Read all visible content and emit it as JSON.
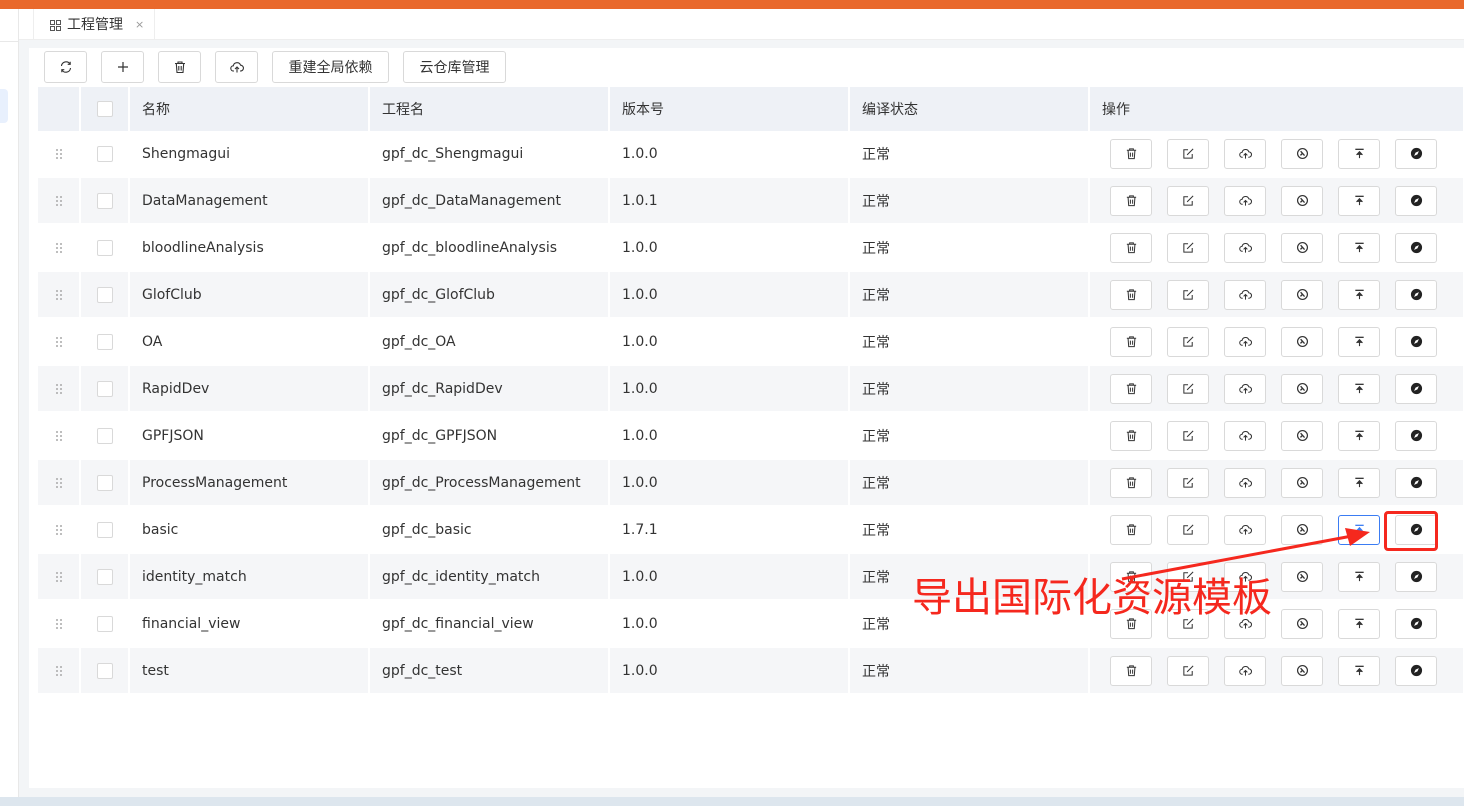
{
  "tabbar": {
    "tab_label": "工程管理",
    "tab_close": "×"
  },
  "toolbar": {
    "rebuild_label": "重建全局依赖",
    "cloud_label": "云仓库管理"
  },
  "table": {
    "headers": [
      "名称",
      "工程名",
      "版本号",
      "编译状态",
      "操作"
    ],
    "rows": [
      {
        "name": "Shengmagui",
        "project": "gpf_dc_Shengmagui",
        "version": "1.0.0",
        "status": "正常"
      },
      {
        "name": "DataManagement",
        "project": "gpf_dc_DataManagement",
        "version": "1.0.1",
        "status": "正常"
      },
      {
        "name": "bloodlineAnalysis",
        "project": "gpf_dc_bloodlineAnalysis",
        "version": "1.0.0",
        "status": "正常"
      },
      {
        "name": "GlofClub",
        "project": "gpf_dc_GlofClub",
        "version": "1.0.0",
        "status": "正常"
      },
      {
        "name": "OA",
        "project": "gpf_dc_OA",
        "version": "1.0.0",
        "status": "正常"
      },
      {
        "name": "RapidDev",
        "project": "gpf_dc_RapidDev",
        "version": "1.0.0",
        "status": "正常"
      },
      {
        "name": "GPFJSON",
        "project": "gpf_dc_GPFJSON",
        "version": "1.0.0",
        "status": "正常"
      },
      {
        "name": "ProcessManagement",
        "project": "gpf_dc_ProcessManagement",
        "version": "1.0.0",
        "status": "正常"
      },
      {
        "name": "basic",
        "project": "gpf_dc_basic",
        "version": "1.7.1",
        "status": "正常"
      },
      {
        "name": "identity_match",
        "project": "gpf_dc_identity_match",
        "version": "1.0.0",
        "status": "正常"
      },
      {
        "name": "financial_view",
        "project": "gpf_dc_financial_view",
        "version": "1.0.0",
        "status": "正常"
      },
      {
        "name": "test",
        "project": "gpf_dc_test",
        "version": "1.0.0",
        "status": "正常"
      }
    ]
  },
  "annotation": {
    "text": "导出国际化资源模板"
  },
  "colors": {
    "accent": "#e9692c",
    "annotation": "#f5281e",
    "active_border": "#3b7cf3"
  }
}
